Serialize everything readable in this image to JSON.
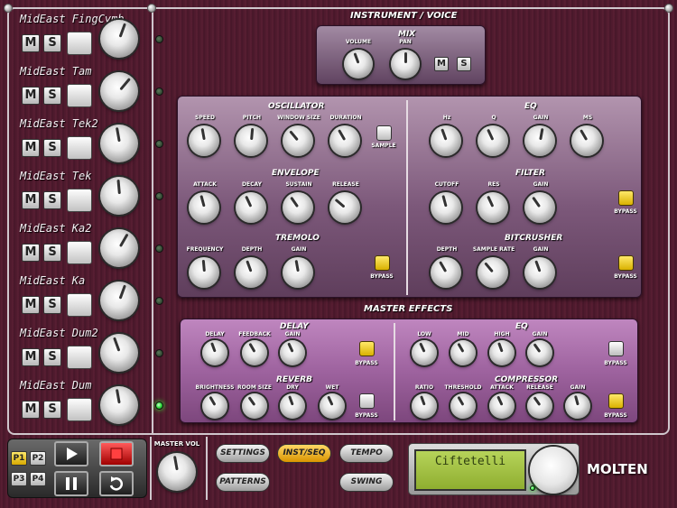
{
  "tracks": [
    {
      "name": "MidEast FingCymb",
      "mute": "M",
      "solo": "S",
      "led_on": false
    },
    {
      "name": "MidEast Tam",
      "mute": "M",
      "solo": "S",
      "led_on": false
    },
    {
      "name": "MidEast Tek2",
      "mute": "M",
      "solo": "S",
      "led_on": false
    },
    {
      "name": "MidEast Tek",
      "mute": "M",
      "solo": "S",
      "led_on": false
    },
    {
      "name": "MidEast Ka2",
      "mute": "M",
      "solo": "S",
      "led_on": false
    },
    {
      "name": "MidEast Ka",
      "mute": "M",
      "solo": "S",
      "led_on": false
    },
    {
      "name": "MidEast Dum2",
      "mute": "M",
      "solo": "S",
      "led_on": false
    },
    {
      "name": "MidEast Dum",
      "mute": "M",
      "solo": "S",
      "led_on": true
    }
  ],
  "instrument": {
    "title": "INSTRUMENT / VOICE",
    "mix": {
      "title": "MIX",
      "volume": "VOLUME",
      "pan": "PAN",
      "mute": "M",
      "solo": "S"
    },
    "oscillator": {
      "title": "OSCILLATOR",
      "speed": "SPEED",
      "pitch": "PITCH",
      "window_size": "WINDOW SIZE",
      "duration": "DURATION",
      "sample": "SAMPLE"
    },
    "envelope": {
      "title": "ENVELOPE",
      "attack": "ATTACK",
      "decay": "DECAY",
      "sustain": "SUSTAIN",
      "release": "RELEASE"
    },
    "tremolo": {
      "title": "TREMOLO",
      "frequency": "FREQUENCY",
      "depth": "DEPTH",
      "gain": "GAIN",
      "bypass": "BYPASS"
    },
    "eq": {
      "title": "EQ",
      "hz": "Hz",
      "q": "Q",
      "gain": "GAIN",
      "ms": "MS"
    },
    "filter": {
      "title": "FILTER",
      "cutoff": "CUTOFF",
      "res": "RES",
      "gain": "GAIN",
      "bypass": "BYPASS"
    },
    "bitcrusher": {
      "title": "BITCRUSHER",
      "depth": "DEPTH",
      "sample_rate": "SAMPLE RATE",
      "gain": "GAIN",
      "bypass": "BYPASS"
    }
  },
  "master": {
    "title": "MASTER EFFECTS",
    "delay": {
      "title": "DELAY",
      "delay": "DELAY",
      "feedback": "FEEDBACK",
      "gain": "GAIN",
      "bypass": "BYPASS"
    },
    "reverb": {
      "title": "REVERB",
      "brightness": "BRIGHTNESS",
      "room_size": "ROOM SIZE",
      "dry": "DRY",
      "wet": "WET",
      "bypass": "BYPASS"
    },
    "eq": {
      "title": "EQ",
      "low": "LOW",
      "mid": "MID",
      "high": "HIGH",
      "gain": "GAIN",
      "bypass": "BYPASS"
    },
    "compressor": {
      "title": "COMPRESSOR",
      "ratio": "RATIO",
      "threshold": "THRESHOLD",
      "attack": "ATTACK",
      "release": "RELEASE",
      "gain": "GAIN",
      "bypass": "BYPASS"
    }
  },
  "transport": {
    "p1": "P1",
    "p2": "P2",
    "p3": "P3",
    "p4": "P4",
    "selected": "P1",
    "master_vol": "MASTER VOL",
    "play_icon": "play-icon",
    "stop_icon": "stop-icon",
    "pause_icon": "pause-icon",
    "loop_icon": "loop-icon"
  },
  "nav": {
    "settings": "SETTINGS",
    "inst_seq": "INST/SEQ",
    "tempo": "TEMPO",
    "patterns": "PATTERNS",
    "swing": "SWING",
    "selected": "INST/SEQ"
  },
  "display": {
    "text": "Ciftetelli"
  },
  "brand": "MOLTEN",
  "colors": {
    "accent": "#f0c419",
    "led_on": "#2fdc3a",
    "lcd": "#a5c246"
  }
}
